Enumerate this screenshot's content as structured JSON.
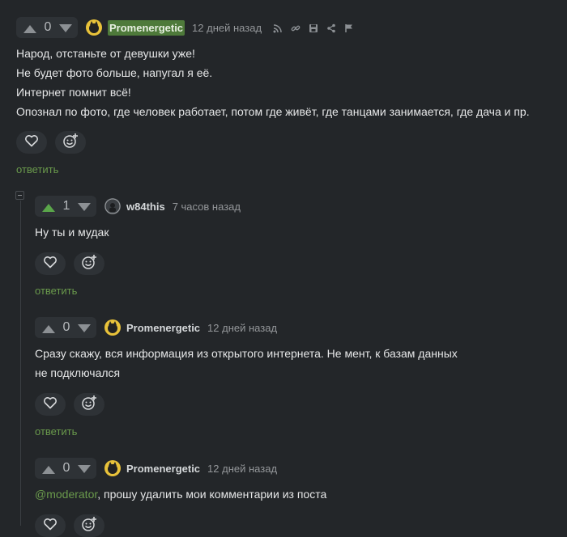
{
  "comments": [
    {
      "rating": "0",
      "author": "Promenergetic",
      "time": "12 дней назад",
      "lines": [
        "Народ, отстаньте от девушки уже!",
        "Не будет фото больше, напугал я её.",
        "Интернет помнит всё!",
        "Опознал по фото, где человек работает, потом где живёт, где танцами занимается, где дача и пр."
      ],
      "reply_label": "ответить"
    },
    {
      "rating": "1",
      "author": "w84this",
      "time": "7 часов назад",
      "lines": [
        "Ну ты и мудак"
      ],
      "reply_label": "ответить"
    },
    {
      "rating": "0",
      "author": "Promenergetic",
      "time": "12 дней назад",
      "lines": [
        "Сразу скажу, вся информация из открытого интернета. Не мент, к базам данных",
        "не подключался"
      ],
      "reply_label": "ответить"
    },
    {
      "rating": "0",
      "author": "Promenergetic",
      "time": "12 дней назад",
      "mention": "@moderator",
      "text_after_mention": ", прошу удалить мои комментарии из поста"
    }
  ],
  "icons": {
    "upvote": "triangle-up-icon",
    "downvote": "triangle-down-icon",
    "like": "heart-icon",
    "react": "add-emoji-icon",
    "rss": "rss-icon",
    "link": "link-icon",
    "save": "save-icon",
    "share": "share-icon",
    "report": "flag-icon"
  },
  "colors": {
    "background": "#232629",
    "accent_green": "#6a9a4c",
    "upvoted": "#5aa64a",
    "author_highlight": "#4e7a3a"
  }
}
